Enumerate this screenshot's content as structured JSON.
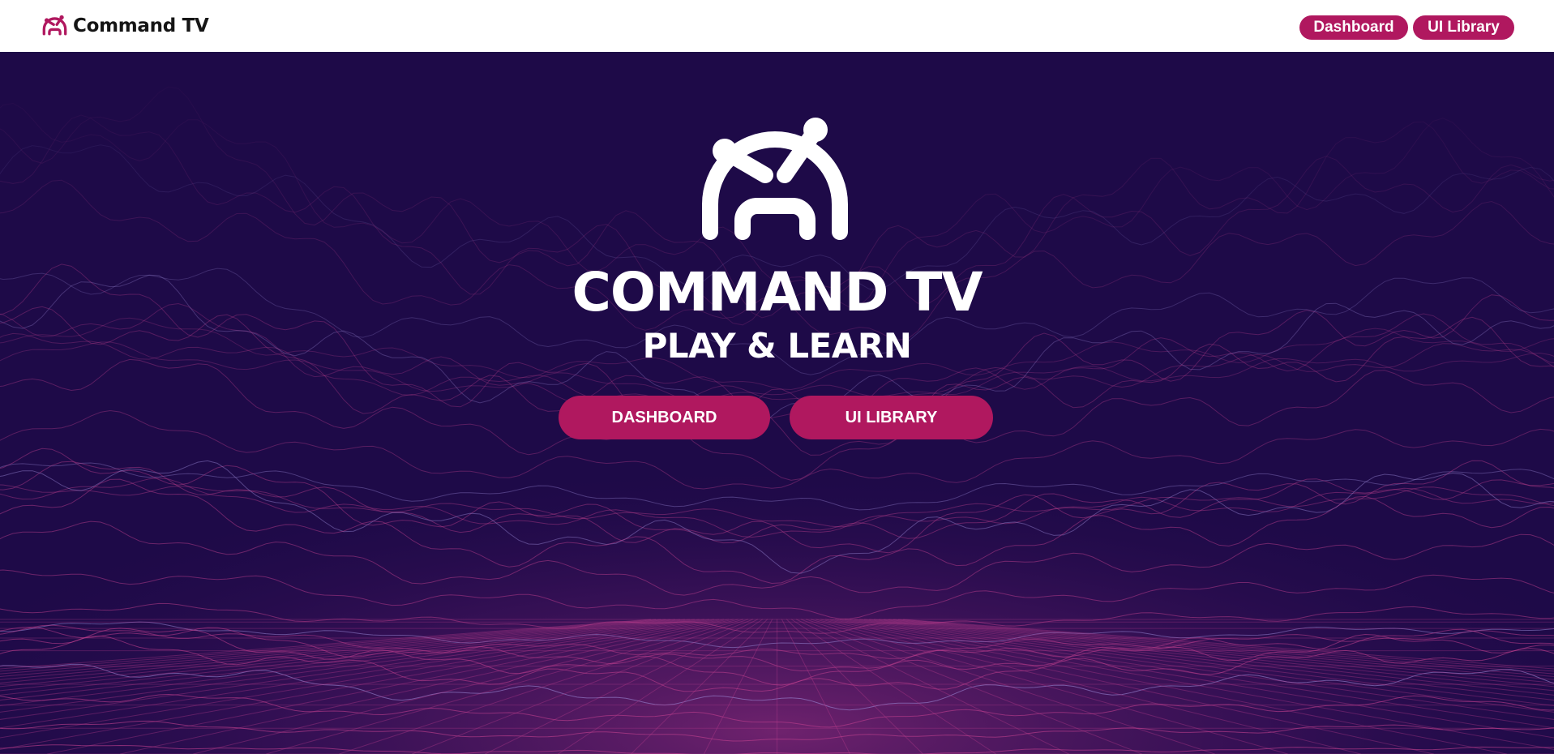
{
  "header": {
    "brand_name": "Command TV",
    "brand_icon": "command-tv-logo-icon",
    "nav": [
      {
        "label": "Dashboard"
      },
      {
        "label": "UI Library"
      }
    ]
  },
  "hero": {
    "logo_icon": "command-tv-logo-icon",
    "title": "COMMAND TV",
    "subtitle": "PLAY & LEARN",
    "buttons": [
      {
        "label": "DASHBOARD"
      },
      {
        "label": "UI LIBRARY"
      }
    ],
    "background": "purple-wireframe-terrain"
  },
  "colors": {
    "brand_accent": "#b0185f",
    "hero_background": "#1e0a48",
    "wireframe": "#c0408e",
    "header_background": "#ffffff"
  }
}
